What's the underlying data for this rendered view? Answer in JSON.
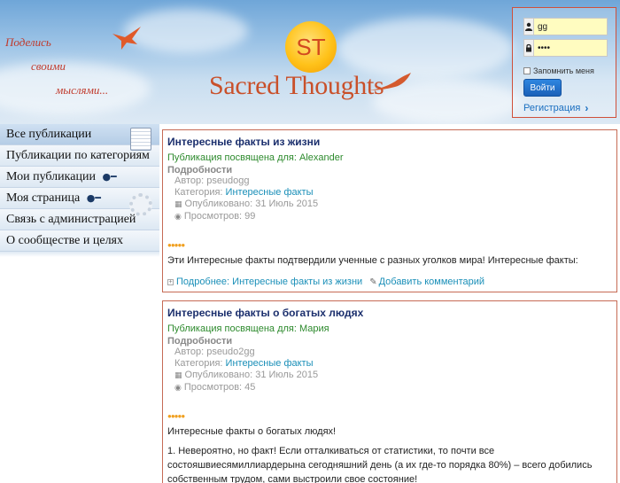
{
  "header": {
    "tagline": [
      "Поделись",
      "своими",
      "мыслями..."
    ],
    "logo_mark": "ST",
    "logo_text": "Sacred Thoughts"
  },
  "login": {
    "username_value": "gg",
    "password_value": "••••",
    "user_icon": "user-icon",
    "lock_icon": "lock-icon",
    "remember_label": "Запомнить меня",
    "submit_label": "Войти",
    "register_label": "Регистрация",
    "register_chevron": "›"
  },
  "sidebar": {
    "items": [
      {
        "label": "Все публикации"
      },
      {
        "label": "Публикации по категориям"
      },
      {
        "label": "Мои публикации"
      },
      {
        "label": "Моя страница"
      },
      {
        "label": "Связь с администрацией"
      },
      {
        "label": "О сообществе и целях"
      }
    ]
  },
  "posts": [
    {
      "title": "Интересные факты из жизни",
      "dedicated": "Публикация посвящена для: Alexander",
      "details_heading": "Подробности",
      "author": "Автор: pseudogg",
      "category_prefix": "Категория: ",
      "category": "Интересные факты",
      "published": "Опубликовано: 31 Июль 2015",
      "views": "Просмотров: 99",
      "body": "Эти Интересные факты подтвердили ученные с разных уголков мира! Интересные факты:",
      "more_link": "Подробнее: Интересные факты из жизни",
      "comment_link": "Добавить комментарий"
    },
    {
      "title": "Интересные факты о богатых людях",
      "dedicated": "Публикация посвящена для: Мария",
      "details_heading": "Подробности",
      "author": "Автор: pseudo2gg",
      "category_prefix": "Категория: ",
      "category": "Интересные факты",
      "published": "Опубликовано: 31 Июль 2015",
      "views": "Просмотров: 45",
      "body": "Интересные факты о богатых людях!",
      "body2": "1. Невероятно, но факт! Если отталкиваться от статистики, то почти все состояшвиесямиллиардерына сегодняшний день (а их где-то порядка 80%) – всего добились собственным трудом,  сами выстроили свое состояние!"
    }
  ],
  "colors": {
    "accent": "#c66b55",
    "link": "#1a8fb8",
    "title": "#1b2f6d",
    "dedication": "#2d8a2d",
    "button": "#1a61b8"
  }
}
